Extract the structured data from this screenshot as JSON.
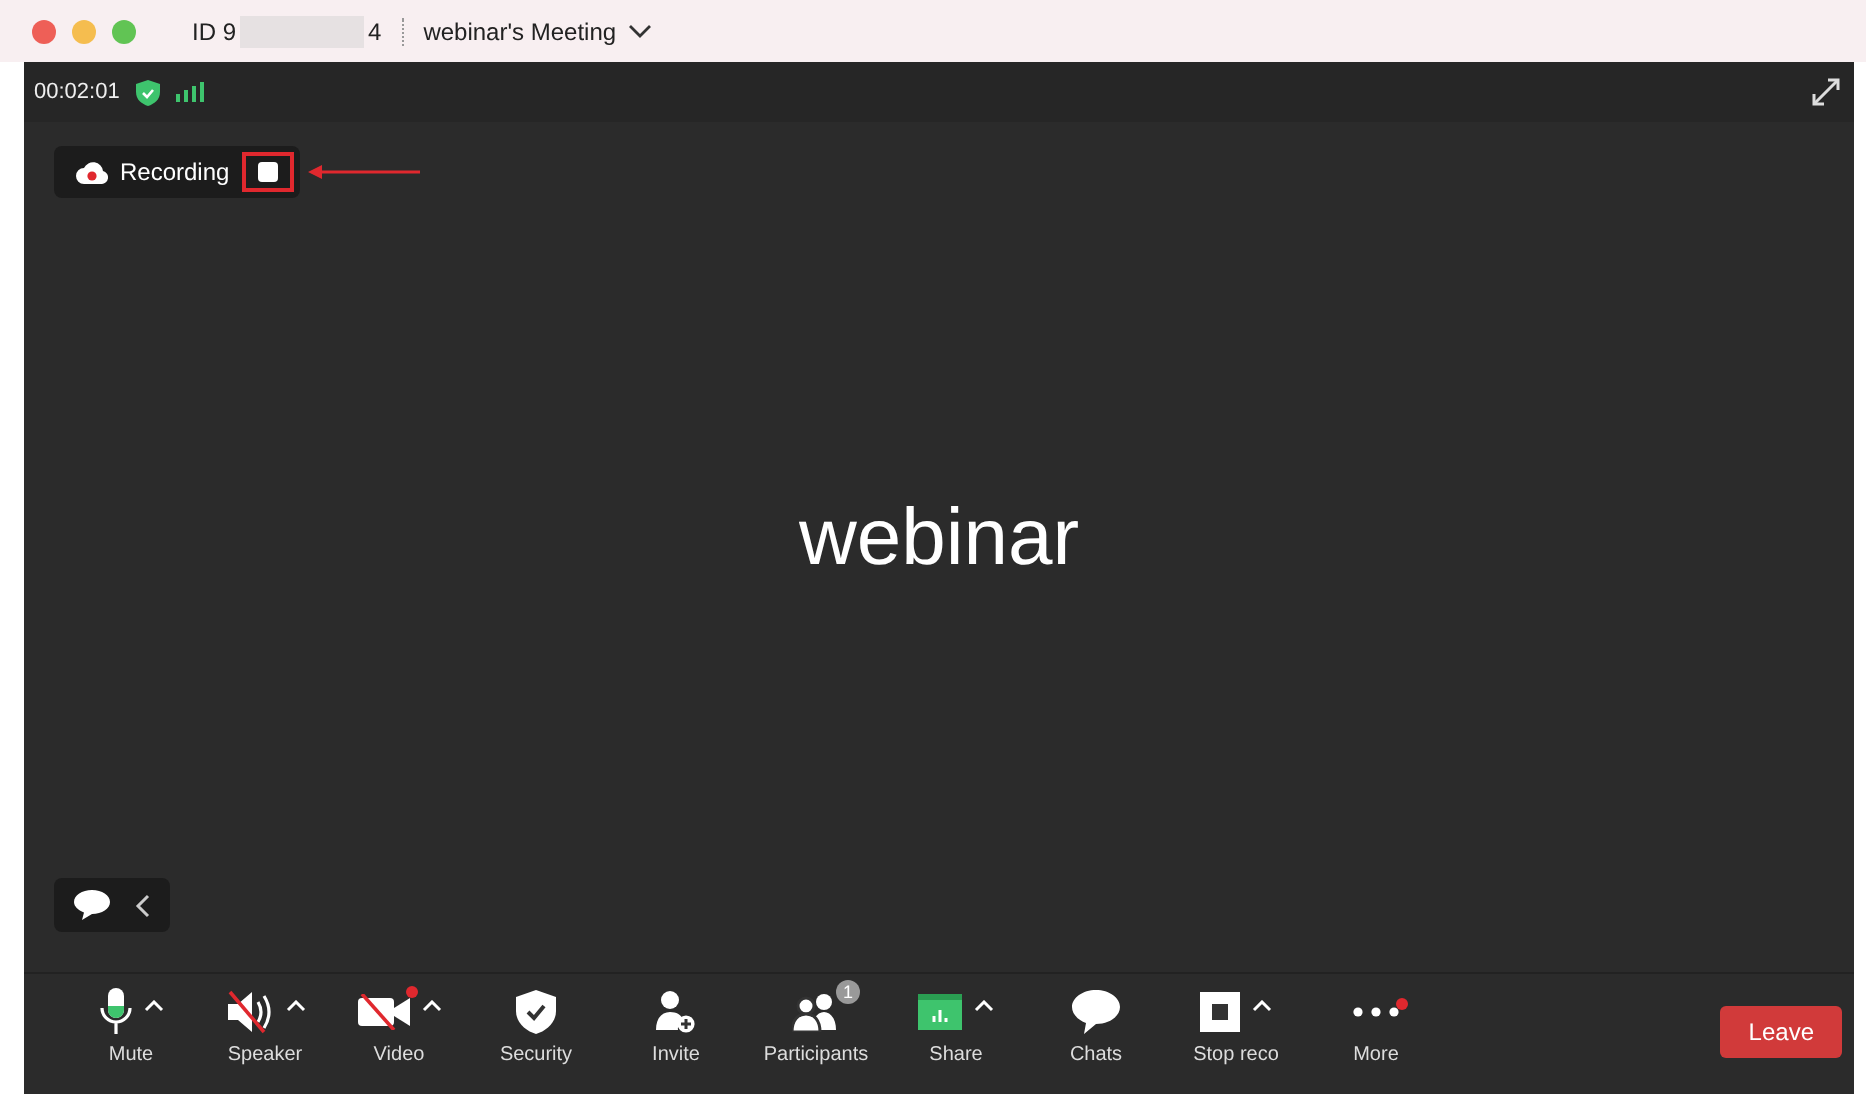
{
  "title_bar": {
    "id_prefix": "ID 9",
    "id_suffix": "4",
    "meeting_title": "webinar's Meeting"
  },
  "status": {
    "timer": "00:02:01"
  },
  "recording": {
    "label": "Recording"
  },
  "main": {
    "name": "webinar"
  },
  "toolbar": [
    {
      "kind": "mic",
      "label": "Mute",
      "caret": true,
      "dot": false
    },
    {
      "kind": "speaker",
      "label": "Speaker",
      "caret": true,
      "dot": false
    },
    {
      "kind": "video",
      "label": "Video",
      "caret": true,
      "dot": true
    },
    {
      "kind": "security",
      "label": "Security",
      "caret": false,
      "dot": false
    },
    {
      "kind": "invite",
      "label": "Invite",
      "caret": false,
      "dot": false
    },
    {
      "kind": "participants",
      "label": "Participants",
      "caret": false,
      "dot": false,
      "badge": "1"
    },
    {
      "kind": "share",
      "label": "Share",
      "caret": true,
      "dot": false
    },
    {
      "kind": "chat",
      "label": "Chats",
      "caret": false,
      "dot": false
    },
    {
      "kind": "stop",
      "label": "Stop reco",
      "caret": true,
      "dot": false
    },
    {
      "kind": "more",
      "label": "More",
      "caret": false,
      "dot": true
    }
  ],
  "leave": {
    "label": "Leave"
  }
}
